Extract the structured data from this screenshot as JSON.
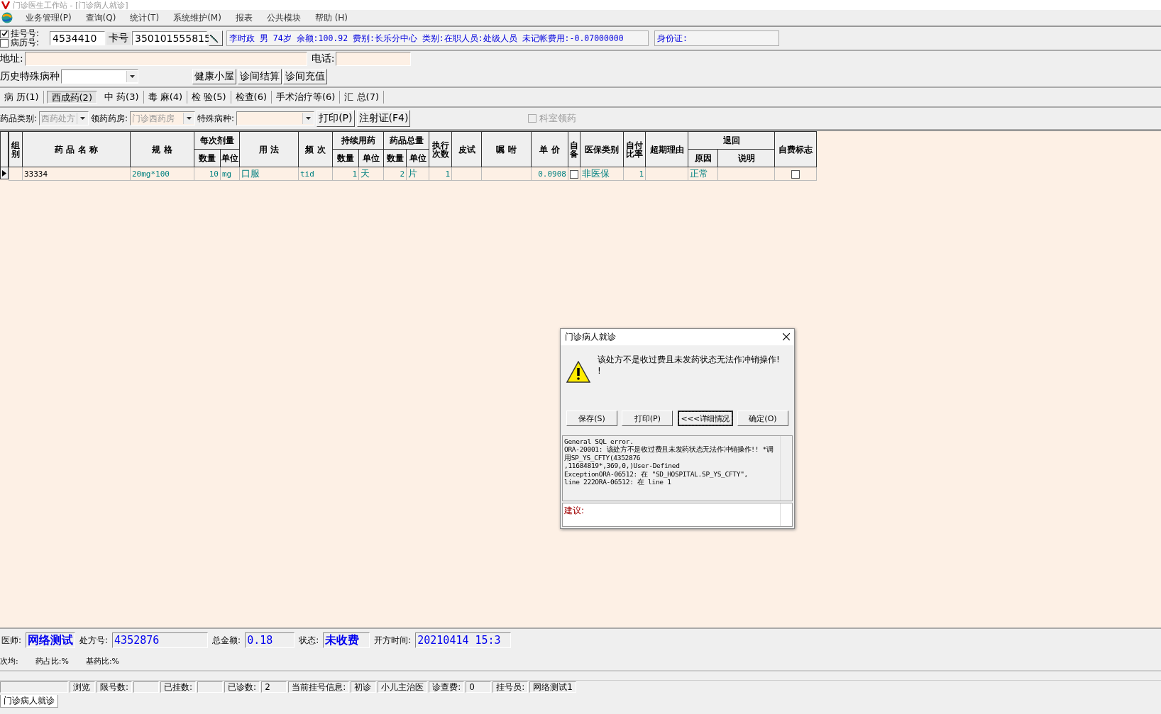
{
  "window": {
    "title": "门诊医生工作站 - [门诊病人就诊]"
  },
  "menu": [
    "业务管理(P)",
    "查询(Q)",
    "统计(T)",
    "系统维护(M)",
    "报表",
    "公共模块",
    "帮助 (H)"
  ],
  "patient": {
    "checks": [
      {
        "label": "挂号号:",
        "checked": true
      },
      {
        "label": "病历号:",
        "checked": false
      }
    ],
    "reg_no": "4534410",
    "card_label": "卡号",
    "card_no": "350101555815",
    "info": "李时政 男 74岁 余额:100.92 费别:长乐分中心 类别:在职人员:处级人员 未记帐费用:-0.07000000",
    "id_label": "身份证:"
  },
  "address": {
    "label": "地址:",
    "phone_label": "电话:"
  },
  "history": {
    "label": "历史特殊病种",
    "buttons": [
      "健康小屋",
      "诊间结算",
      "诊间充值"
    ]
  },
  "tabs": [
    {
      "label": "病 历(1)",
      "selected": false
    },
    {
      "label": "西成药(2)",
      "selected": true
    },
    {
      "label": "中 药(3)",
      "selected": false
    },
    {
      "label": "毒 麻(4)",
      "selected": false
    },
    {
      "label": "检 验(5)",
      "selected": false
    },
    {
      "label": "检查(6)",
      "selected": false
    },
    {
      "label": "手术治疗等(6)",
      "selected": false
    },
    {
      "label": "汇 总(7)",
      "selected": false
    }
  ],
  "filter": {
    "category_label": "药品类别:",
    "category_value": "西药处方",
    "pharmacy_label": "领药药房:",
    "pharmacy_value": "门诊西药房",
    "special_label": "特殊病种:",
    "buttons": [
      "打印(P)",
      "注射证(F4)"
    ],
    "dept_check": {
      "label": "科室领药",
      "checked": false
    }
  },
  "table": {
    "columns": [
      {
        "label": "组别",
        "kind": "text"
      },
      {
        "label": "药 品 名 称",
        "kind": "name"
      },
      {
        "label": "规 格",
        "kind": "text"
      },
      {
        "label": "每次剂量",
        "children": [
          {
            "label": "数量",
            "kind": "number"
          },
          {
            "label": "单位",
            "kind": "text"
          }
        ]
      },
      {
        "label": "用 法",
        "kind": "text"
      },
      {
        "label": "频 次",
        "kind": "text"
      },
      {
        "label": "持续用药",
        "children": [
          {
            "label": "数量",
            "kind": "number"
          },
          {
            "label": "单位",
            "kind": "text"
          }
        ]
      },
      {
        "label": "药品总量",
        "children": [
          {
            "label": "数量",
            "kind": "number"
          },
          {
            "label": "单位",
            "kind": "text"
          }
        ]
      },
      {
        "label": "执行次数",
        "kind": "number"
      },
      {
        "label": "皮试",
        "kind": "text"
      },
      {
        "label": "嘱 咐",
        "kind": "text"
      },
      {
        "label": "单 价",
        "kind": "number"
      },
      {
        "label": "自备",
        "kind": "check"
      },
      {
        "label": "医保类别",
        "kind": "text"
      },
      {
        "label": "自付比率",
        "kind": "number"
      },
      {
        "label": "超期理由",
        "kind": "text"
      },
      {
        "label": "退回",
        "children": [
          {
            "label": "原因",
            "kind": "text"
          },
          {
            "label": "说明",
            "kind": "text"
          }
        ]
      },
      {
        "label": "自费标志",
        "kind": "check"
      }
    ],
    "rows": [
      {
        "current": true,
        "cells": [
          null,
          "33334",
          "20mg*100",
          [
            "10",
            "mg"
          ],
          "口服",
          "tid",
          [
            "1",
            "天"
          ],
          [
            "2",
            "片"
          ],
          "1",
          null,
          null,
          "0.0908",
          false,
          "非医保",
          "1",
          null,
          [
            "正常",
            null
          ],
          false
        ]
      }
    ]
  },
  "footer": {
    "fields": [
      {
        "label": "医师:",
        "value": "网络测试",
        "kind": "short"
      },
      {
        "label": "处方号:",
        "value": "4352876",
        "kind": "long"
      },
      {
        "label": "总金额:",
        "value": "0.18",
        "kind": "mid"
      },
      {
        "label": "状态:",
        "value": "未收费",
        "kind": "short"
      },
      {
        "label": "开方时间:",
        "value": "20210414 15:3",
        "kind": "long"
      }
    ],
    "stats": [
      "次均:",
      "药占比:%",
      "基药比:%"
    ]
  },
  "status_bar": [
    {
      "label": "浏览",
      "kind": "mode"
    },
    {
      "label": "限号数:",
      "kind": "field"
    },
    {
      "label": "已挂数:",
      "kind": "field"
    },
    {
      "label": "已诊数:",
      "kind": "field",
      "values": [
        "2"
      ]
    },
    {
      "label": "当前挂号信息:",
      "kind": "field",
      "values": [
        "初诊",
        "小儿主治医"
      ]
    },
    {
      "label": "诊查费:",
      "kind": "field",
      "values": [
        "0"
      ]
    },
    {
      "label": "挂号员:",
      "kind": "field",
      "values": [
        "网络测试1"
      ]
    }
  ],
  "taskbar_tab": "门诊病人就诊",
  "dialog": {
    "title": "门诊病人就诊",
    "message": "该处方不是收过费且未发药状态无法作冲销操作!\n!",
    "buttons": [
      {
        "label": "保存(S)",
        "focused": false
      },
      {
        "label": "打印(P)",
        "focused": false
      },
      {
        "label": "<<<详细情况",
        "focused": true
      },
      {
        "label": "确定(O)",
        "focused": false
      }
    ],
    "details": "General SQL error.\nORA-20001: 该处方不是收过费且未发药状态无法作冲销操作!! *调用SP_YS_CFTY(4352876\n,11684819*,369,0,)User-Defined\nExceptionORA-06512: 在 \"SD_HOSPITAL.SP_YS_CFTY\",\nline 222ORA-06512: 在 line 1",
    "advice_label": "建议:"
  }
}
